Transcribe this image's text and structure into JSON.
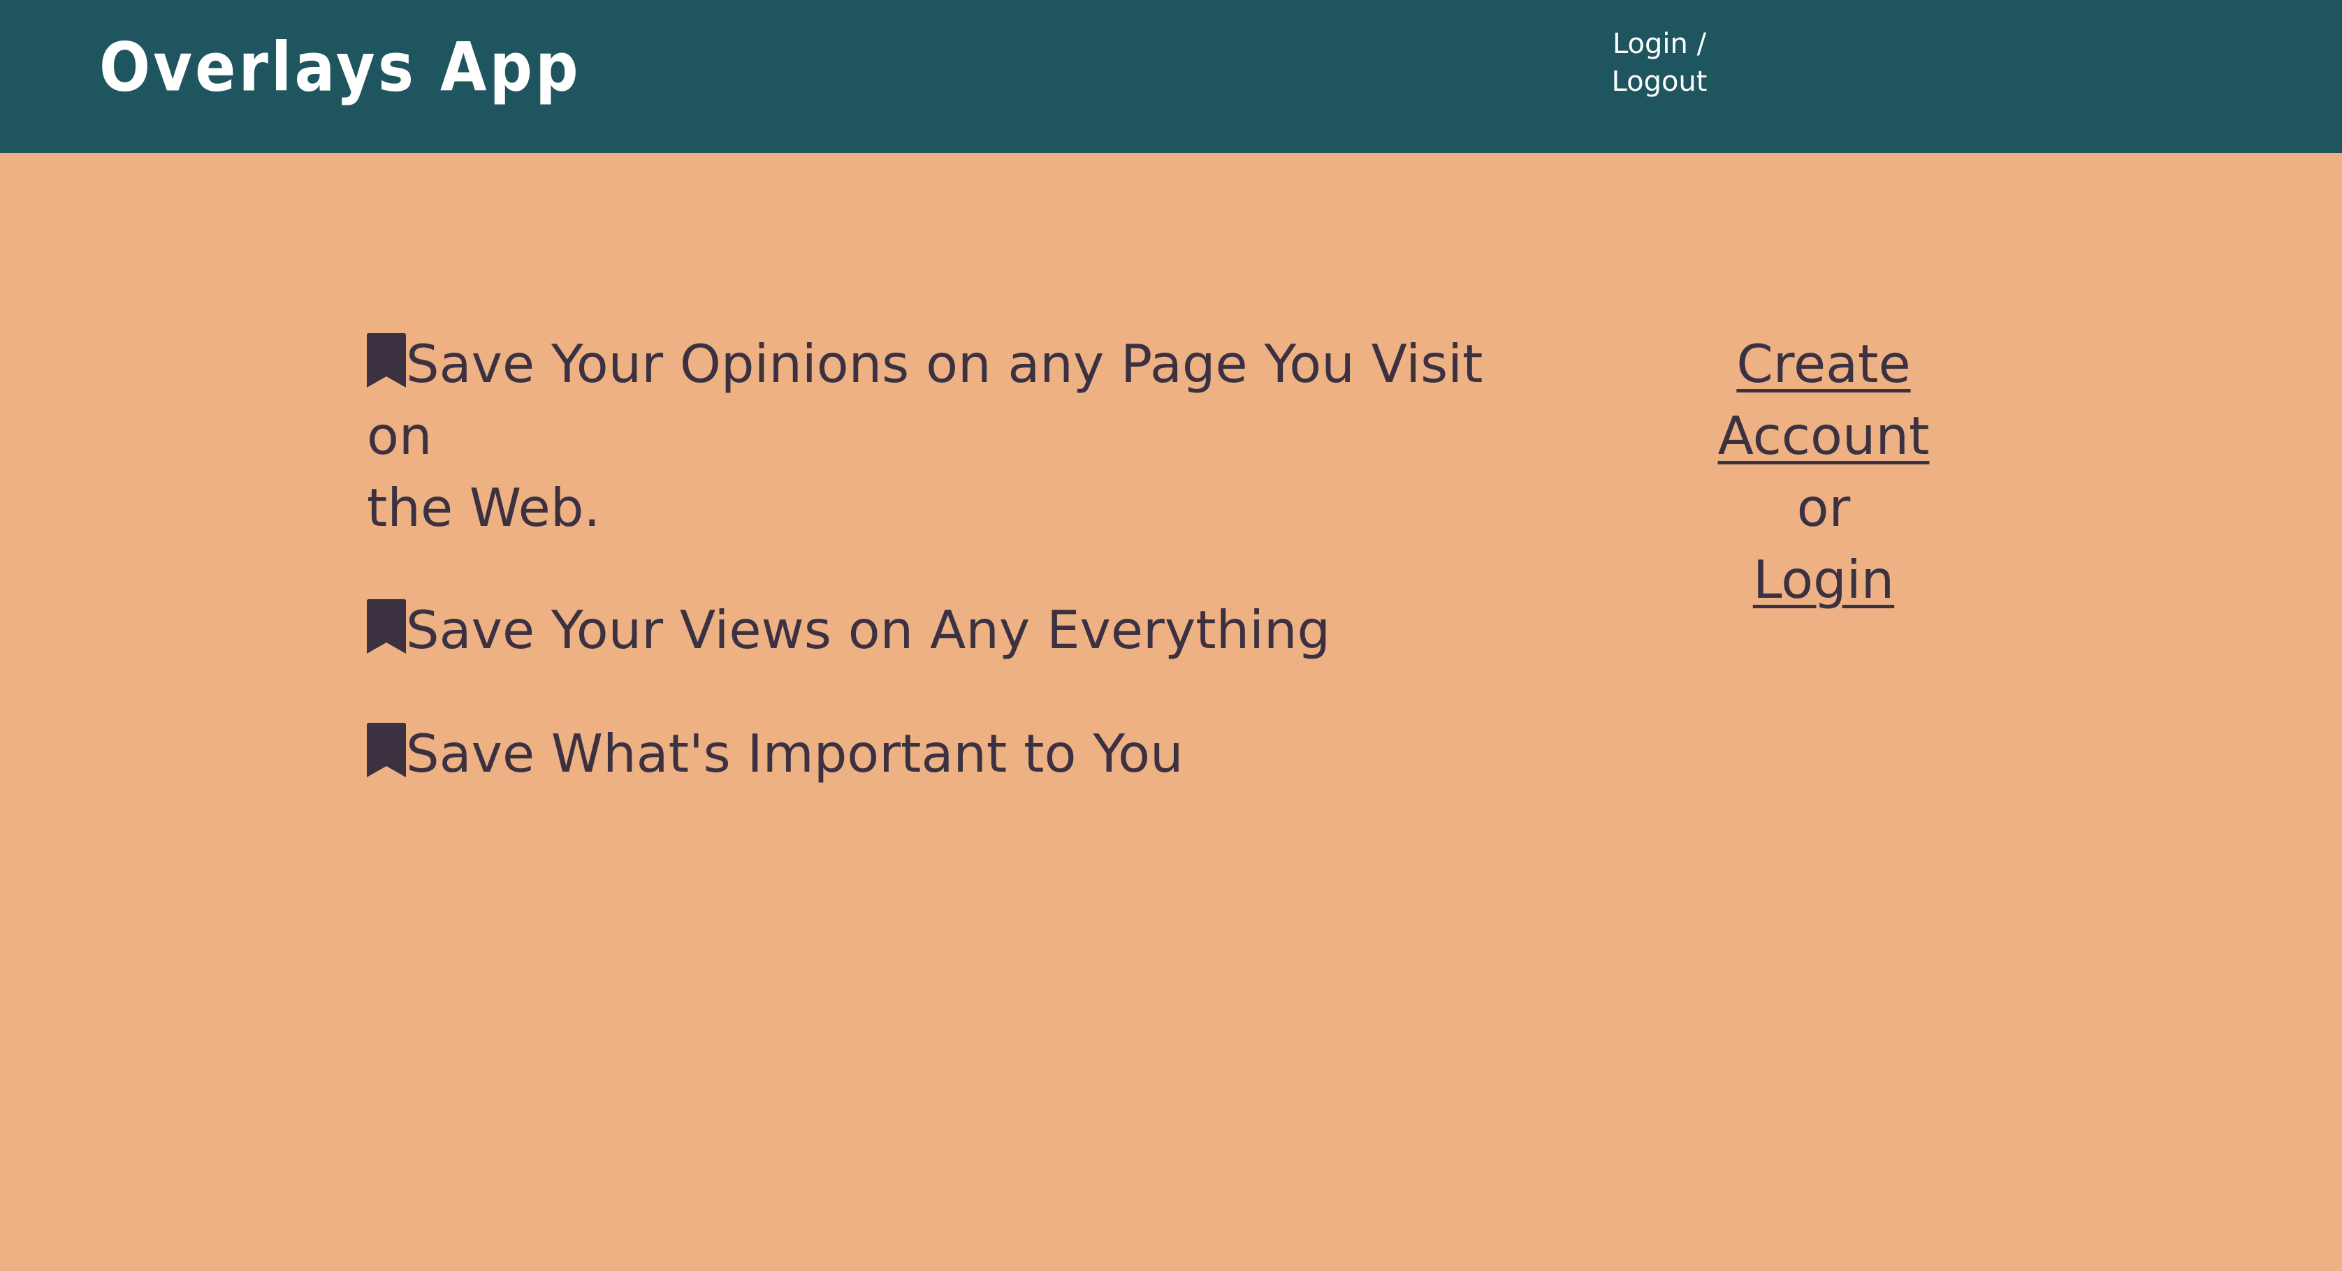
{
  "header": {
    "brand": "Overlays App",
    "auth_nav_line1": "Login /",
    "auth_nav_line2": "Logout"
  },
  "features": [
    {
      "icon": "bookmark-icon",
      "text_line1": "Save Your Opinions on any Page You Visit on",
      "text_line2": "the Web."
    },
    {
      "icon": "bookmark-icon",
      "text": "Save Your Views on Any Everything"
    },
    {
      "icon": "bookmark-icon",
      "text": "Save What's Important to You"
    }
  ],
  "cta": {
    "create_line1": "Create",
    "create_line2": "Account",
    "or": "or",
    "login": "Login"
  },
  "colors": {
    "background": "#EDB184",
    "header": "#1F555F",
    "text": "#3B3140",
    "header_text": "#FFFFFF"
  }
}
